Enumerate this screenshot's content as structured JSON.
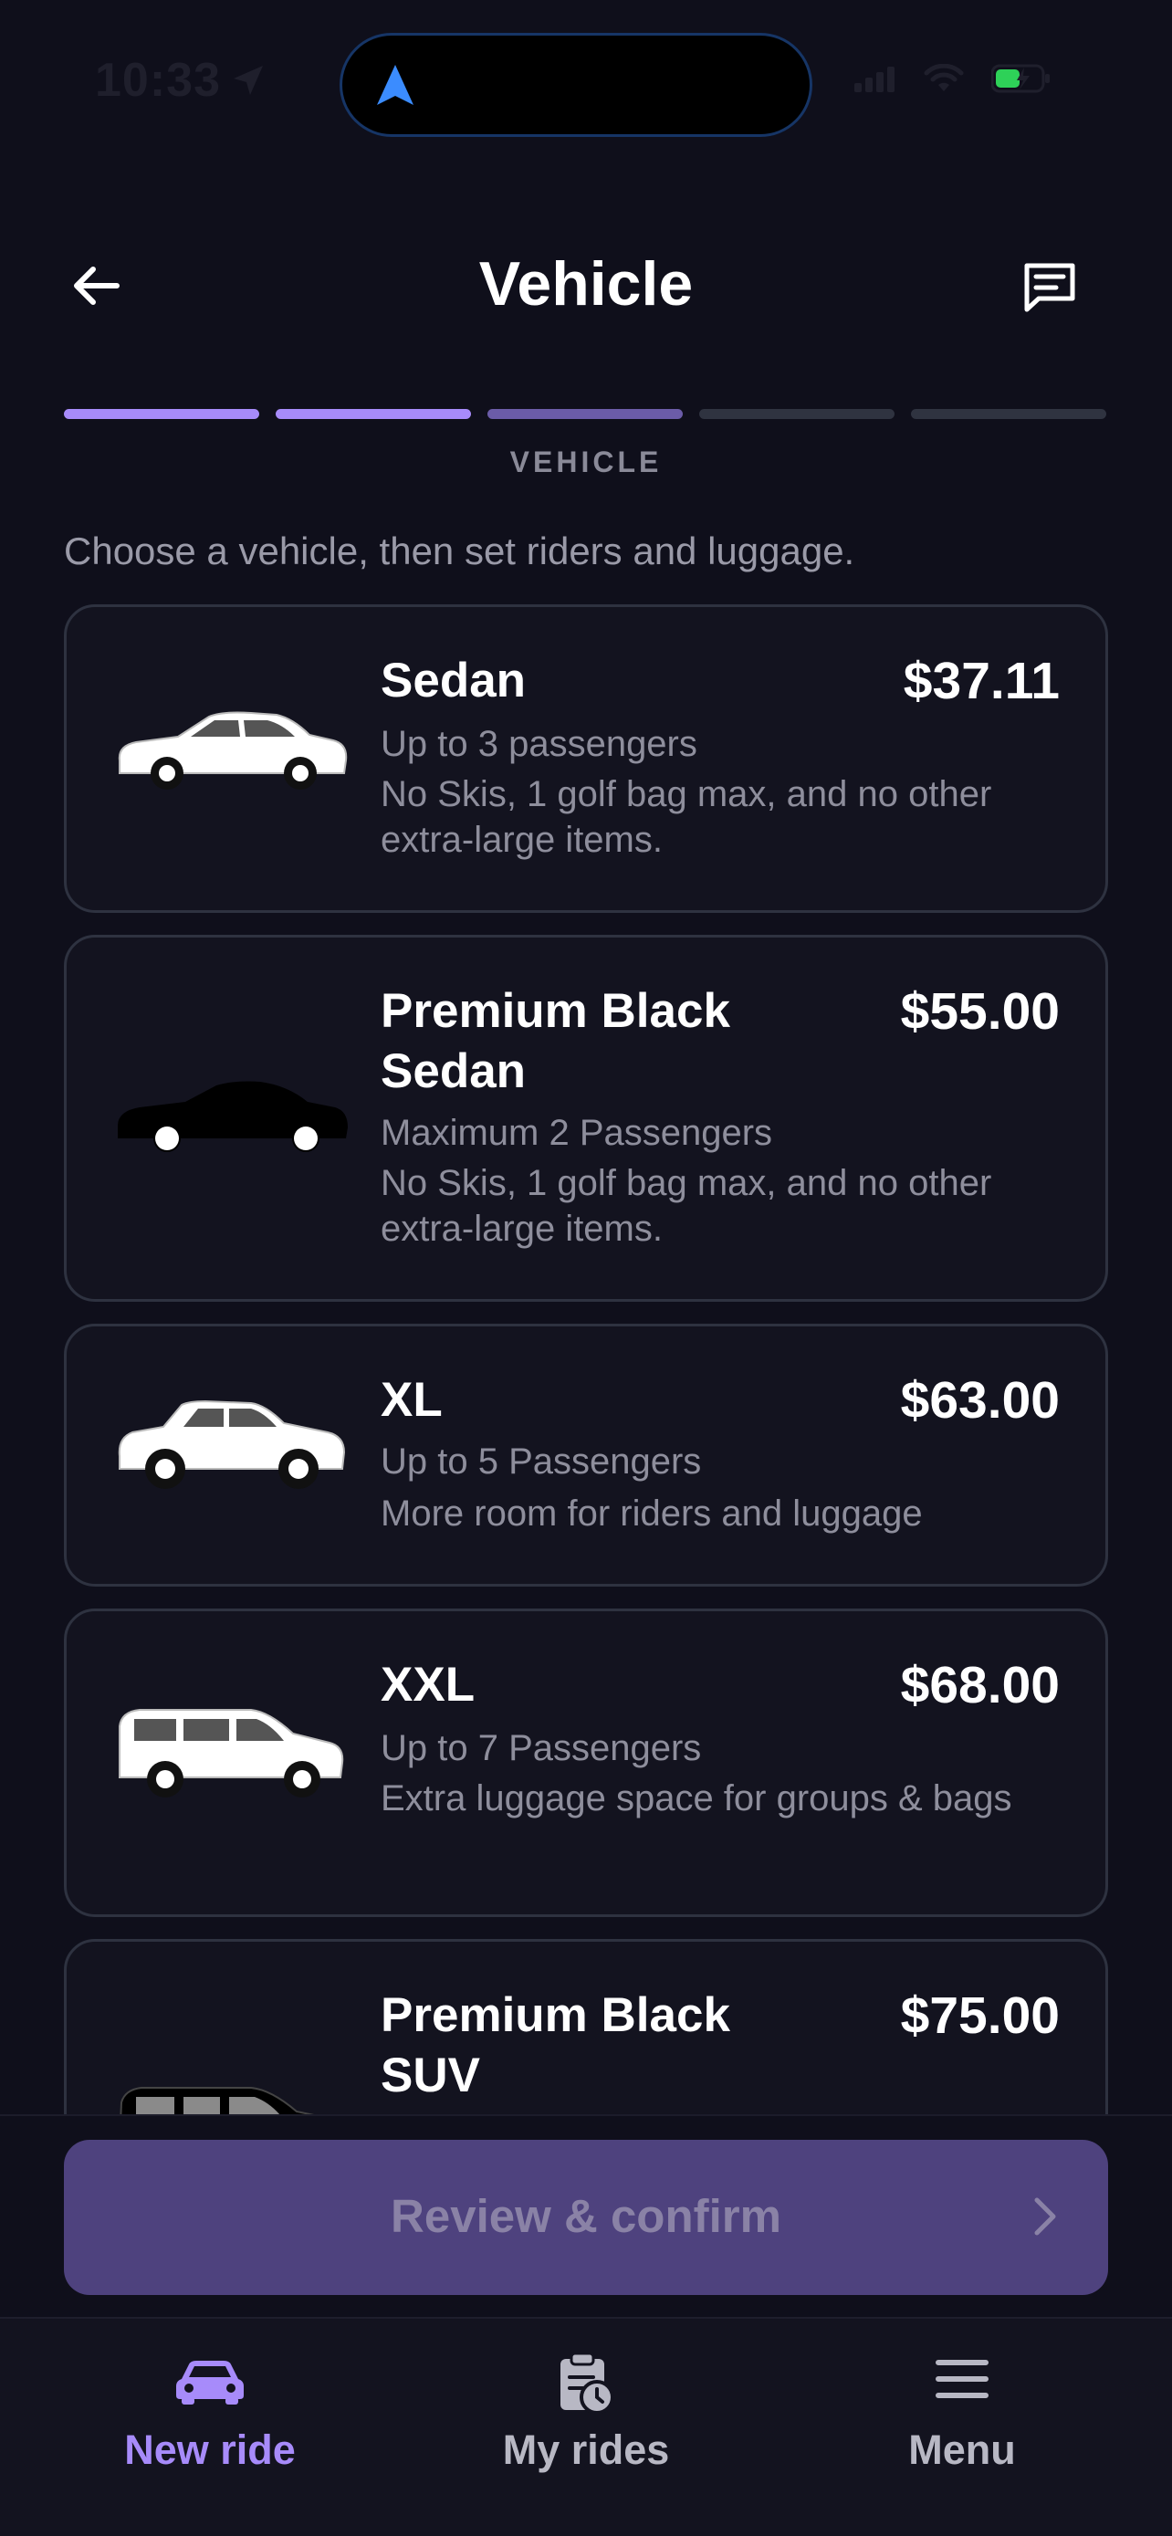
{
  "status_bar": {
    "time": "10:33"
  },
  "header": {
    "title": "Vehicle"
  },
  "progress": {
    "total_steps": 5,
    "completed_steps": 2,
    "current_step": 3,
    "step_label": "VEHICLE"
  },
  "intro": "Choose a vehicle, then set riders and luggage.",
  "vehicles": [
    {
      "name": "Sedan",
      "price": "$37.11",
      "capacity": "Up to 3 passengers",
      "note": "No Skis, 1 golf bag max, and no other extra-large items.",
      "icon": "white-sedan"
    },
    {
      "name": "Premium Black Sedan",
      "price": "$55.00",
      "capacity": "Maximum 2 Passengers",
      "note": "No Skis, 1 golf bag max, and no other extra-large items.",
      "icon": "black-sedan"
    },
    {
      "name": "XL",
      "price": "$63.00",
      "capacity": "Up to 5 Passengers",
      "note": "More room for riders and luggage",
      "icon": "white-suv"
    },
    {
      "name": "XXL",
      "price": "$68.00",
      "capacity": "Up to 7 Passengers",
      "note": "Extra luggage space for groups & bags",
      "icon": "white-minivan"
    },
    {
      "name": "Premium Black SUV",
      "price": "$75.00",
      "icon": "black-suv"
    }
  ],
  "cta": {
    "label": "Review & confirm",
    "enabled": false
  },
  "bottom_nav": {
    "items": [
      {
        "label": "New ride",
        "icon": "car-icon",
        "active": true
      },
      {
        "label": "My rides",
        "icon": "clipboard-clock-icon",
        "active": false
      },
      {
        "label": "Menu",
        "icon": "hamburger-menu-icon",
        "active": false
      }
    ]
  },
  "colors": {
    "background": "#0f0f1b",
    "card": "#13131f",
    "accent": "#a78bfa",
    "accent_dim": "#6b5ca8",
    "cta_disabled": "#4e427e",
    "muted_text": "#8e8e9c"
  }
}
